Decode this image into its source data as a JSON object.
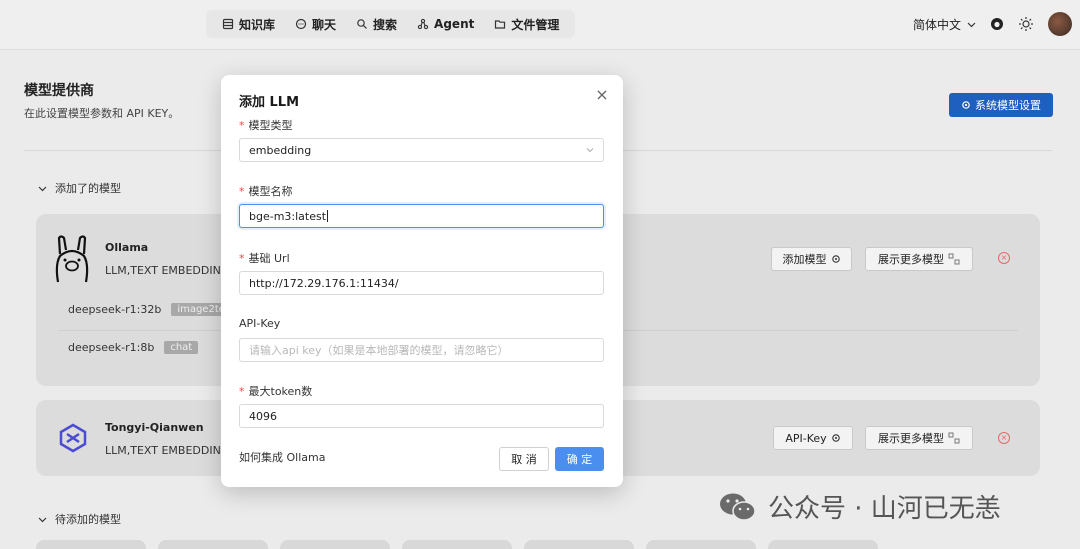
{
  "nav": {
    "items": [
      {
        "label": "知识库",
        "icon": "database-icon"
      },
      {
        "label": "聊天",
        "icon": "chat-icon"
      },
      {
        "label": "搜索",
        "icon": "search-icon"
      },
      {
        "label": "Agent",
        "icon": "agent-icon"
      },
      {
        "label": "文件管理",
        "icon": "folder-icon"
      }
    ],
    "language": "简体中文"
  },
  "page": {
    "title": "模型提供商",
    "subtitle": "在此设置模型参数和 API KEY。",
    "system_settings_button": "系统模型设置",
    "added_section": "添加了的模型",
    "pending_section": "待添加的模型"
  },
  "providers": [
    {
      "name": "Ollama",
      "tags": "LLM,TEXT EMBEDDING",
      "buttons": [
        "添加模型",
        "展示更多模型"
      ],
      "models": [
        {
          "name": "deepseek-r1:32b",
          "tag": "image2text"
        },
        {
          "name": "deepseek-r1:8b",
          "tag": "chat"
        }
      ]
    },
    {
      "name": "Tongyi-Qianwen",
      "tags": "LLM,TEXT EMBEDDING",
      "buttons": [
        "API-Key",
        "展示更多模型"
      ]
    }
  ],
  "modal": {
    "title": "添加 LLM",
    "fields": {
      "model_type": {
        "label": "模型类型",
        "value": "embedding",
        "required": "*"
      },
      "model_name": {
        "label": "模型名称",
        "value": "bge-m3:latest",
        "required": "*"
      },
      "base_url": {
        "label": "基础 Url",
        "value": "http://172.29.176.1:11434/",
        "required": "*"
      },
      "api_key": {
        "label": "API-Key",
        "placeholder": "请输入api key（如果是本地部署的模型，请忽略它）"
      },
      "max_tokens": {
        "label": "最大token数",
        "value": "4096",
        "required": "*"
      }
    },
    "help_link": "如何集成 Ollama",
    "cancel_label": "取 消",
    "ok_label": "确 定"
  },
  "watermark": "公众号 · 山河已无恙",
  "colors": {
    "primary": "#4a8ff0",
    "system_button": "#1f5fbf",
    "required": "#e24c4c",
    "delete": "#e26a6a"
  }
}
